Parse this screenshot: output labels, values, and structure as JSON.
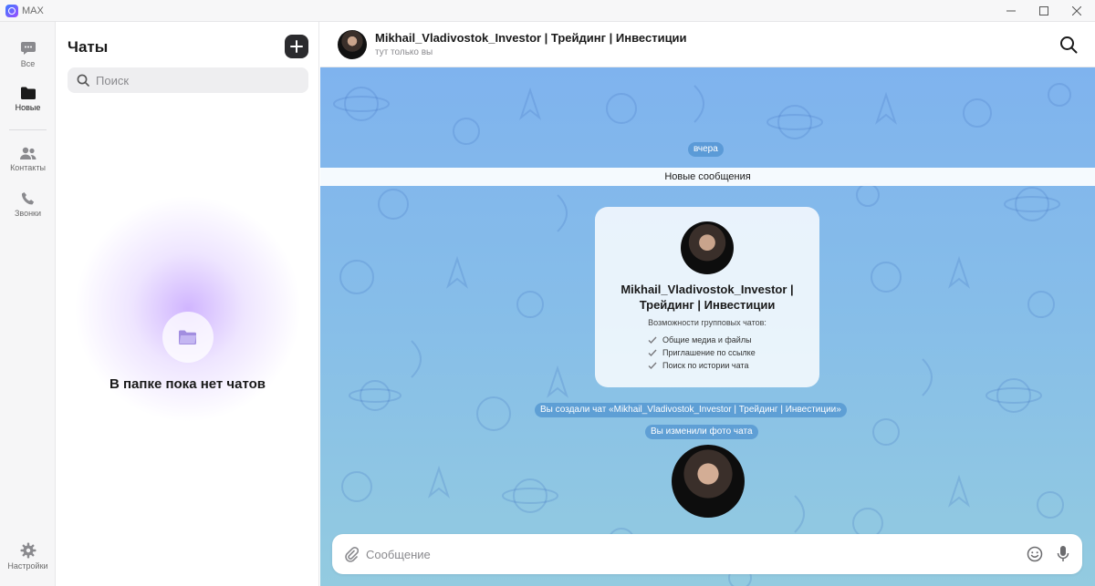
{
  "app": {
    "title": "MAX"
  },
  "window": {
    "minimize_icon": "—",
    "maximize_icon": "☐",
    "close_icon": "✕"
  },
  "rail": {
    "items": [
      {
        "label": "Все",
        "icon": "chat-bubble-icon"
      },
      {
        "label": "Новые",
        "icon": "folder-icon"
      },
      {
        "label": "Контакты",
        "icon": "contacts-icon"
      },
      {
        "label": "Звонки",
        "icon": "phone-icon"
      }
    ],
    "settings_label": "Настройки"
  },
  "chat_list": {
    "title": "Чаты",
    "search_placeholder": "Поиск",
    "empty_text": "В папке пока нет чатов"
  },
  "chat": {
    "title": "Mikhail_Vladivostok_Investor | Трейдинг | Инвестиции",
    "subtitle": "тут только вы",
    "date_divider": "вчера",
    "new_messages_label": "Новые сообщения",
    "card": {
      "title": "Mikhail_Vladivostok_Investor | Трейдинг | Инвестиции",
      "subtitle": "Возможности групповых чатов:",
      "features": [
        "Общие медиа и файлы",
        "Приглашение по ссылке",
        "Поиск по истории чата"
      ]
    },
    "system_messages": [
      "Вы создали чат «Mikhail_Vladivostok_Investor | Трейдинг | Инвестиции»",
      "Вы изменили фото чата"
    ],
    "composer_placeholder": "Сообщение"
  },
  "colors": {
    "accent": "#2b2b2e",
    "chat_bg_top": "#7fb3ee",
    "chat_bg_bottom": "#93cbe0",
    "pill": "#468ccd"
  }
}
